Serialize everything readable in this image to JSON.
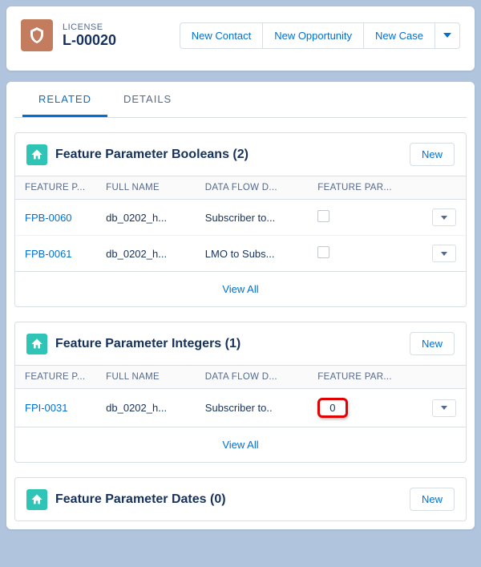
{
  "header": {
    "object_label": "LICENSE",
    "record_name": "L-00020",
    "actions": {
      "new_contact": "New Contact",
      "new_opportunity": "New Opportunity",
      "new_case": "New Case"
    }
  },
  "tabs": {
    "related": "RELATED",
    "details": "DETAILS"
  },
  "sections": {
    "booleans": {
      "title": "Feature Parameter Booleans (2)",
      "new_label": "New",
      "columns": [
        "FEATURE P...",
        "FULL NAME",
        "DATA FLOW D...",
        "FEATURE PAR..."
      ],
      "rows": [
        {
          "id": "FPB-0060",
          "full_name": "db_0202_h...",
          "flow": "Subscriber to..."
        },
        {
          "id": "FPB-0061",
          "full_name": "db_0202_h...",
          "flow": "LMO to Subs..."
        }
      ],
      "view_all": "View All"
    },
    "integers": {
      "title": "Feature Parameter Integers (1)",
      "new_label": "New",
      "columns": [
        "FEATURE P...",
        "FULL NAME",
        "DATA FLOW D...",
        "FEATURE PAR..."
      ],
      "rows": [
        {
          "id": "FPI-0031",
          "full_name": "db_0202_h...",
          "flow": "Subscriber to..",
          "value": "0"
        }
      ],
      "view_all": "View All"
    },
    "dates": {
      "title": "Feature Parameter Dates (0)",
      "new_label": "New"
    }
  }
}
